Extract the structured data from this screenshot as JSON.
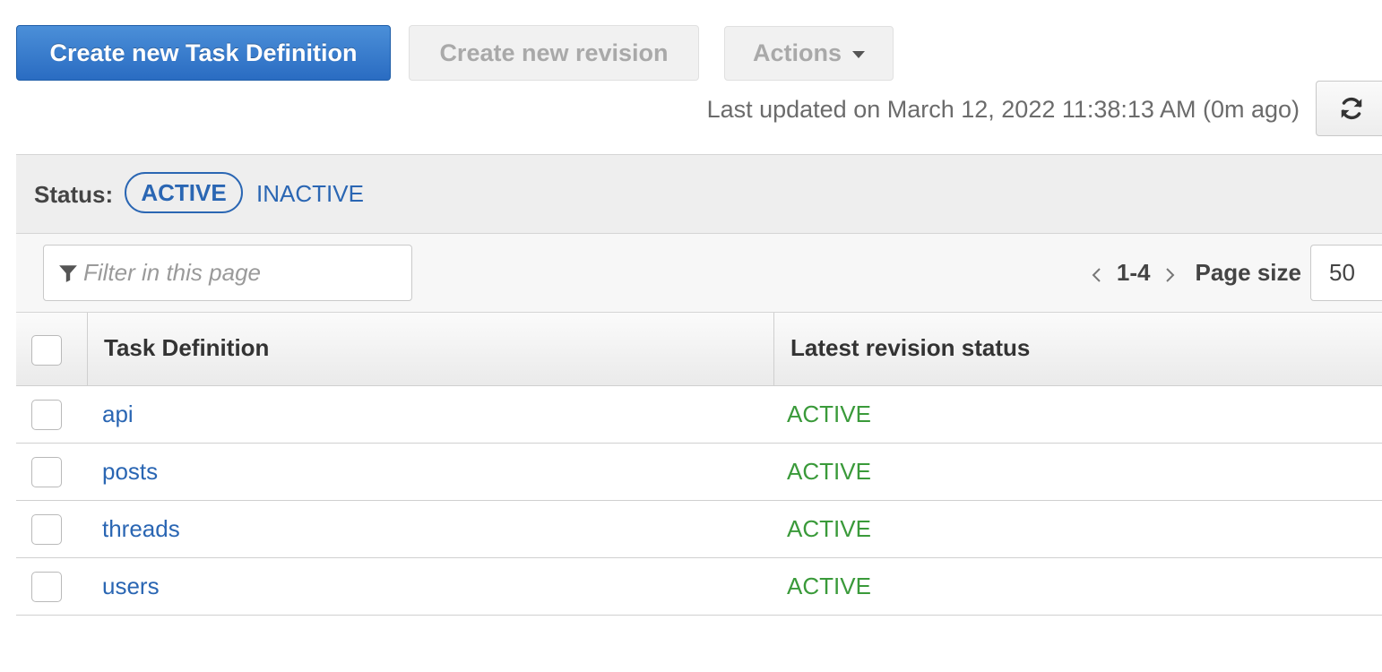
{
  "toolbar": {
    "create_task_definition_label": "Create new Task Definition",
    "create_revision_label": "Create new revision",
    "actions_label": "Actions",
    "last_updated": "Last updated on March 12, 2022 11:38:13 AM (0m ago)",
    "refresh_icon": "refresh-icon"
  },
  "status_filter": {
    "label": "Status:",
    "active_label": "ACTIVE",
    "inactive_label": "INACTIVE",
    "selected": "ACTIVE"
  },
  "filter": {
    "placeholder": "Filter in this page",
    "value": "",
    "icon": "funnel-icon"
  },
  "pagination": {
    "range": "1-4",
    "page_size_label": "Page size",
    "page_size_value": "50"
  },
  "table": {
    "columns": [
      "Task Definition",
      "Latest revision status"
    ],
    "rows": [
      {
        "name": "api",
        "status": "ACTIVE"
      },
      {
        "name": "posts",
        "status": "ACTIVE"
      },
      {
        "name": "threads",
        "status": "ACTIVE"
      },
      {
        "name": "users",
        "status": "ACTIVE"
      }
    ]
  },
  "colors": {
    "primary": "#2a6cc2",
    "link": "#2a66b3",
    "status_active": "#3a9a3a"
  }
}
